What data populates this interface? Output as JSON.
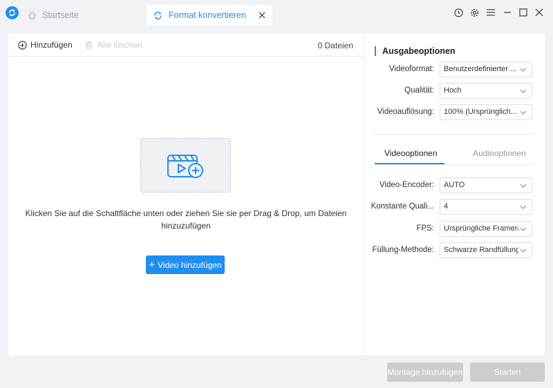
{
  "titlebar": {
    "home_tab": "Startseite",
    "active_tab": "Format konvertieren"
  },
  "toolbar": {
    "add_label": "Hinzufügen",
    "clear_label": "Alle löschen",
    "file_count": "0 Dateien"
  },
  "dropzone": {
    "hint": "Klicken Sie auf die Schaltfläche unten oder ziehen Sie sie per Drag & Drop, um Dateien hinzuzufügen",
    "add_video_label": "Video hinzufügen"
  },
  "output": {
    "title": "Ausgabeoptionen",
    "format_label": "Videoformat:",
    "format_value": "Benutzerdefinierter ...",
    "quality_label": "Qualität:",
    "quality_value": "Hoch",
    "resolution_label": "Videoauflösung:",
    "resolution_value": "100% (Ursprünglich..."
  },
  "subtabs": {
    "video": "Videooptionen",
    "audio": "Audiooptionen"
  },
  "video_options": {
    "encoder_label": "Video-Encoder:",
    "encoder_value": "AUTO",
    "crf_label": "Konstante Quali...",
    "crf_value": "4",
    "fps_label": "FPS:",
    "fps_value": "Ursprüngliche Framera",
    "fill_label": "Füllung-Methode:",
    "fill_value": "Schwarze Randfüllung"
  },
  "footer": {
    "montage_label": "Montage hinzufügen",
    "start_label": "Starten"
  },
  "colors": {
    "accent": "#1e8ef2",
    "disabled": "#cbcdd1"
  }
}
